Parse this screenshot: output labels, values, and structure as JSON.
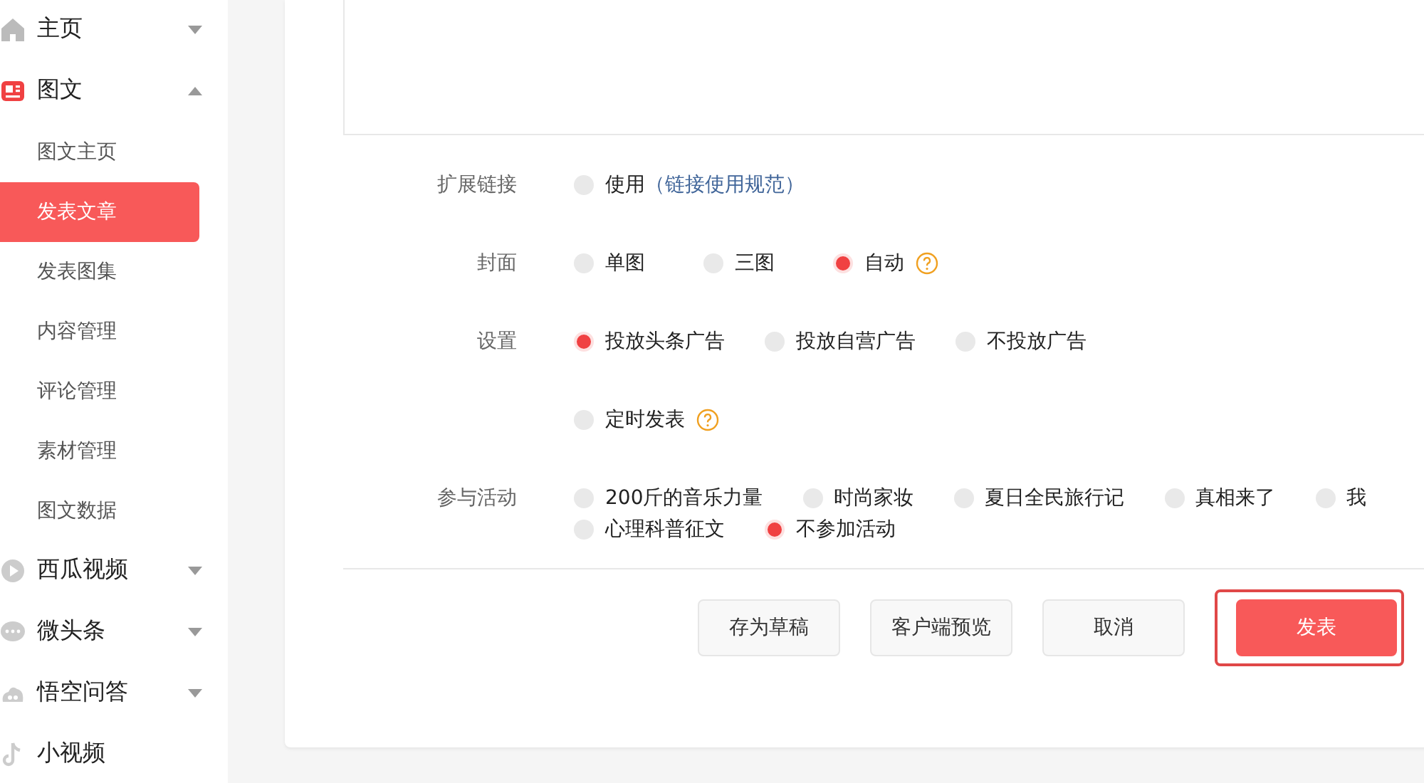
{
  "sidebar": {
    "items": [
      {
        "label": "主页",
        "kind": "home",
        "expanded": false
      },
      {
        "label": "图文",
        "kind": "article",
        "expanded": true,
        "children": [
          {
            "label": "图文主页",
            "selected": false
          },
          {
            "label": "发表文章",
            "selected": true
          },
          {
            "label": "发表图集",
            "selected": false
          },
          {
            "label": "内容管理",
            "selected": false
          },
          {
            "label": "评论管理",
            "selected": false
          },
          {
            "label": "素材管理",
            "selected": false
          },
          {
            "label": "图文数据",
            "selected": false
          }
        ]
      },
      {
        "label": "西瓜视频",
        "kind": "video",
        "expanded": false
      },
      {
        "label": "微头条",
        "kind": "chat",
        "expanded": false
      },
      {
        "label": "悟空问答",
        "kind": "qa",
        "expanded": false
      },
      {
        "label": "小视频",
        "kind": "short-video"
      }
    ]
  },
  "form": {
    "rows": [
      {
        "label": "扩展链接",
        "options": [
          {
            "label": "使用",
            "link": "（链接使用规范）",
            "selected": false
          }
        ]
      },
      {
        "label": "封面",
        "options": [
          {
            "label": "单图",
            "selected": false
          },
          {
            "label": "三图",
            "selected": false
          },
          {
            "label": "自动",
            "selected": true,
            "help": true
          }
        ]
      },
      {
        "label": "设置",
        "options": [
          {
            "label": "投放头条广告",
            "selected": true
          },
          {
            "label": "投放自营广告",
            "selected": false
          },
          {
            "label": "不投放广告",
            "selected": false
          }
        ]
      },
      {
        "options": [
          {
            "label": "定时发表",
            "selected": false,
            "help": true
          }
        ]
      },
      {
        "label": "参与活动",
        "options": [
          {
            "label": "200斤的音乐力量",
            "selected": false
          },
          {
            "label": "时尚家妆",
            "selected": false
          },
          {
            "label": "夏日全民旅行记",
            "selected": false
          },
          {
            "label": "真相来了",
            "selected": false
          },
          {
            "label": "我",
            "selected": false
          },
          {
            "label": "心理科普征文",
            "selected": false
          },
          {
            "label": "不参加活动",
            "selected": true
          }
        ]
      }
    ],
    "buttons": [
      {
        "label": "存为草稿",
        "kind": "default",
        "focused": false
      },
      {
        "label": "客户端预览",
        "kind": "default",
        "focused": false
      },
      {
        "label": "取消",
        "kind": "default",
        "focused": false
      },
      {
        "label": "发表",
        "kind": "primary",
        "focused": true
      }
    ]
  }
}
